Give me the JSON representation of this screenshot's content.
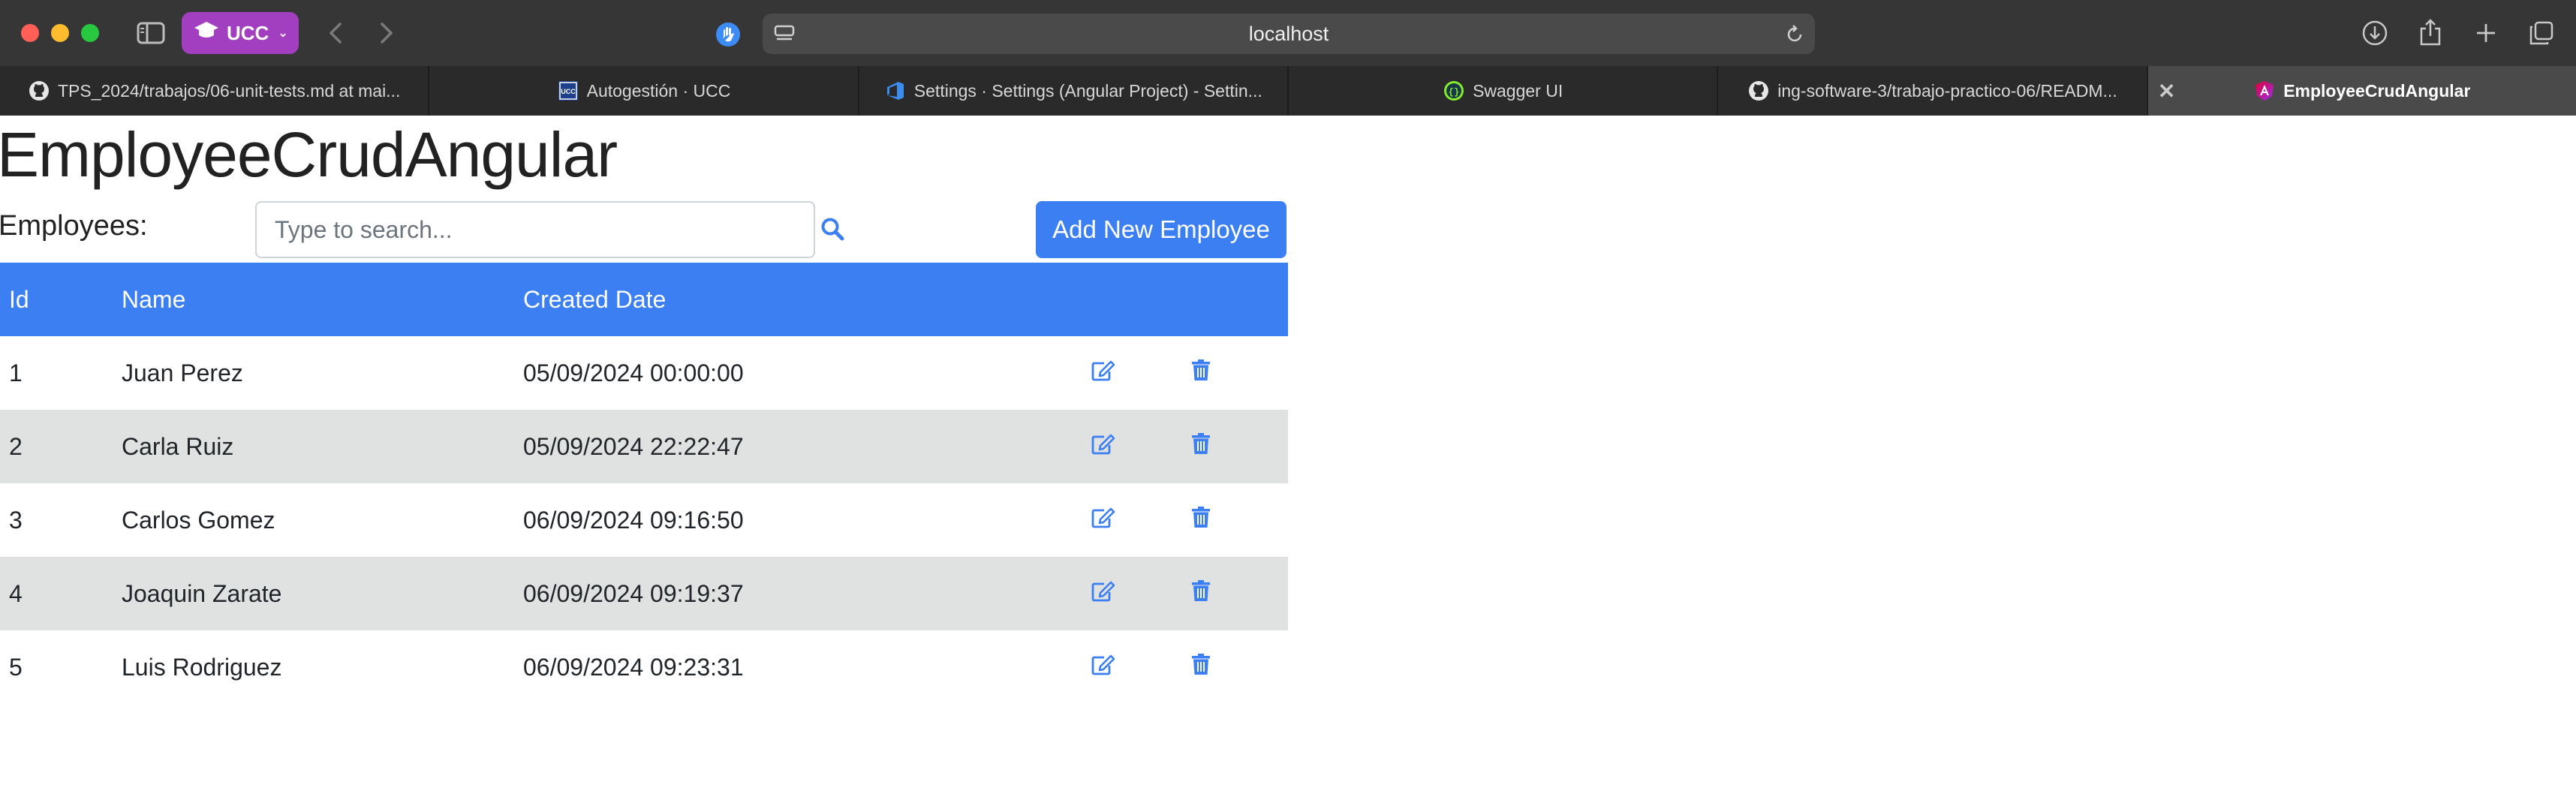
{
  "browser": {
    "profile_label": "UCC",
    "address": "localhost",
    "tabs": [
      {
        "label": "TPS_2024/trabajos/06-unit-tests.md at mai...",
        "icon": "github-icon",
        "active": false
      },
      {
        "label": "Autogestión · UCC",
        "icon": "ucc-logo-icon",
        "active": false
      },
      {
        "label": "Settings · Settings (Angular Project) - Settin...",
        "icon": "azure-devops-icon",
        "active": false
      },
      {
        "label": "Swagger UI",
        "icon": "swagger-icon",
        "active": false
      },
      {
        "label": "ing-software-3/trabajo-practico-06/READM...",
        "icon": "github-icon",
        "active": false
      },
      {
        "label": "EmployeeCrudAngular",
        "icon": "angular-icon",
        "active": true
      }
    ],
    "ucc_logo_text": "UCC"
  },
  "page": {
    "title": "EmployeeCrudAngular",
    "employees_label": "Employees:",
    "search_placeholder": "Type to search...",
    "add_button": "Add New Employee"
  },
  "table": {
    "headers": {
      "id": "Id",
      "name": "Name",
      "created": "Created Date"
    },
    "rows": [
      {
        "id": "1",
        "name": "Juan Perez",
        "created": "05/09/2024 00:00:00"
      },
      {
        "id": "2",
        "name": "Carla Ruiz",
        "created": "05/09/2024 22:22:47"
      },
      {
        "id": "3",
        "name": "Carlos Gomez",
        "created": "06/09/2024 09:16:50"
      },
      {
        "id": "4",
        "name": "Joaquin Zarate",
        "created": "06/09/2024 09:19:37"
      },
      {
        "id": "5",
        "name": "Luis Rodriguez",
        "created": "06/09/2024 09:23:31"
      }
    ]
  },
  "colors": {
    "primary": "#3b7ff2",
    "striped_row": "#e0e1e1",
    "toolbar": "#363636",
    "profile_pill": "#a23ec0"
  }
}
